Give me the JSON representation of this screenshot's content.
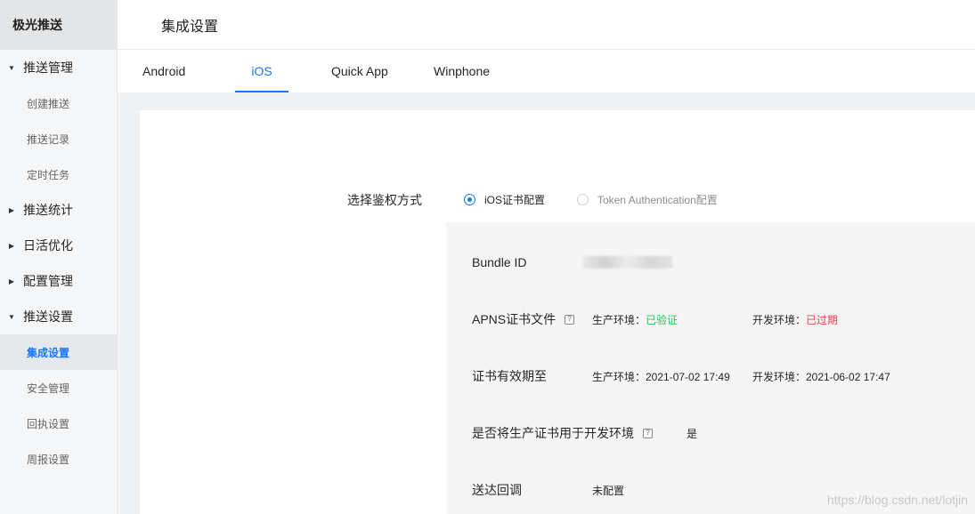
{
  "brand": "极光推送",
  "header": {
    "title": "集成设置"
  },
  "sidebar": {
    "groups": [
      {
        "label": "推送管理",
        "expanded": true,
        "items": [
          "创建推送",
          "推送记录",
          "定时任务"
        ]
      },
      {
        "label": "推送统计",
        "expanded": false,
        "items": []
      },
      {
        "label": "日活优化",
        "expanded": false,
        "items": []
      },
      {
        "label": "配置管理",
        "expanded": false,
        "items": []
      },
      {
        "label": "推送设置",
        "expanded": true,
        "items": [
          "集成设置",
          "安全管理",
          "回执设置",
          "周报设置"
        ]
      }
    ],
    "active_item": "集成设置"
  },
  "tabs": {
    "items": [
      "Android",
      "iOS",
      "Quick App",
      "Winphone"
    ],
    "active": "iOS"
  },
  "auth": {
    "label": "选择鉴权方式",
    "options": [
      {
        "label": "iOS证书配置",
        "checked": true
      },
      {
        "label": "Token Authentication配置",
        "checked": false
      }
    ]
  },
  "config": {
    "bundle_id_label": "Bundle ID",
    "apns_label": "APNS证书文件",
    "apns_prod_prefix": "生产环境：",
    "apns_prod_status": "已验证",
    "apns_dev_prefix": "开发环境：",
    "apns_dev_status": "已过期",
    "validity_label": "证书有效期至",
    "validity_prod": "生产环境：2021-07-02 17:49",
    "validity_dev": "开发环境：2021-06-02 17:47",
    "use_prod_label": "是否将生产证书用于开发环境",
    "use_prod_value": "是",
    "callback_label": "送达回调",
    "callback_value": "未配置"
  },
  "watermark": "https://blog.csdn.net/lotjin",
  "colors": {
    "accent": "#1677ff",
    "ok": "#2fbd51",
    "bad": "#e5464a"
  }
}
